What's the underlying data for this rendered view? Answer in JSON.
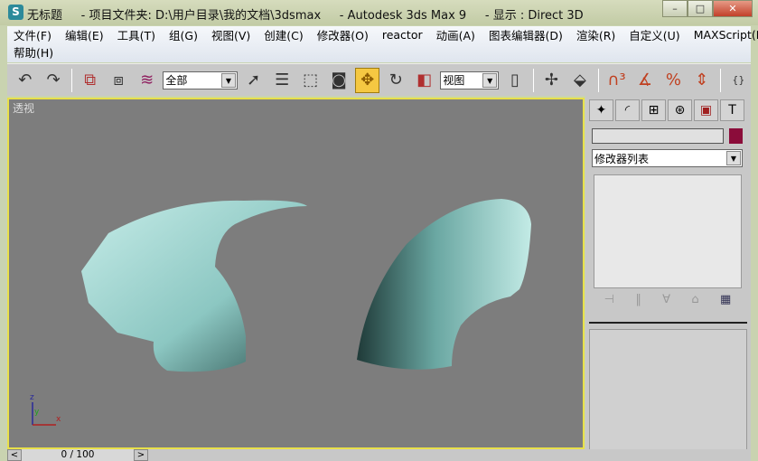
{
  "window": {
    "title": "无标题     - 项目文件夹: D:\\用户目录\\我的文档\\3dsmax     - Autodesk 3ds Max 9     - 显示 : Direct 3D",
    "app_icon": "3dsmax-logo-icon",
    "minimize": "–",
    "maximize": "□",
    "close": "✕"
  },
  "menu": {
    "row1": [
      "文件(F)",
      "编辑(E)",
      "工具(T)",
      "组(G)",
      "视图(V)",
      "创建(C)",
      "修改器(O)",
      "reactor",
      "动画(A)",
      "图表编辑器(D)",
      "渲染(R)",
      "自定义(U)",
      "MAXScript(M)"
    ],
    "row2": [
      "帮助(H)"
    ]
  },
  "toolbar": {
    "selection_filter": "全部",
    "reference_coord": "视图",
    "active_tool": "select-and-move"
  },
  "viewport": {
    "label": "透视",
    "background": "#7d7d7d",
    "border_color": "#e8e04a",
    "axis": {
      "z": "z",
      "y": "y",
      "x": "x"
    }
  },
  "command_panel": {
    "object_color": "#8b0c3a",
    "modifier_list": "修改器列表"
  },
  "timeline": {
    "frame": "0 / 100",
    "prev": "<",
    "next": ">"
  }
}
